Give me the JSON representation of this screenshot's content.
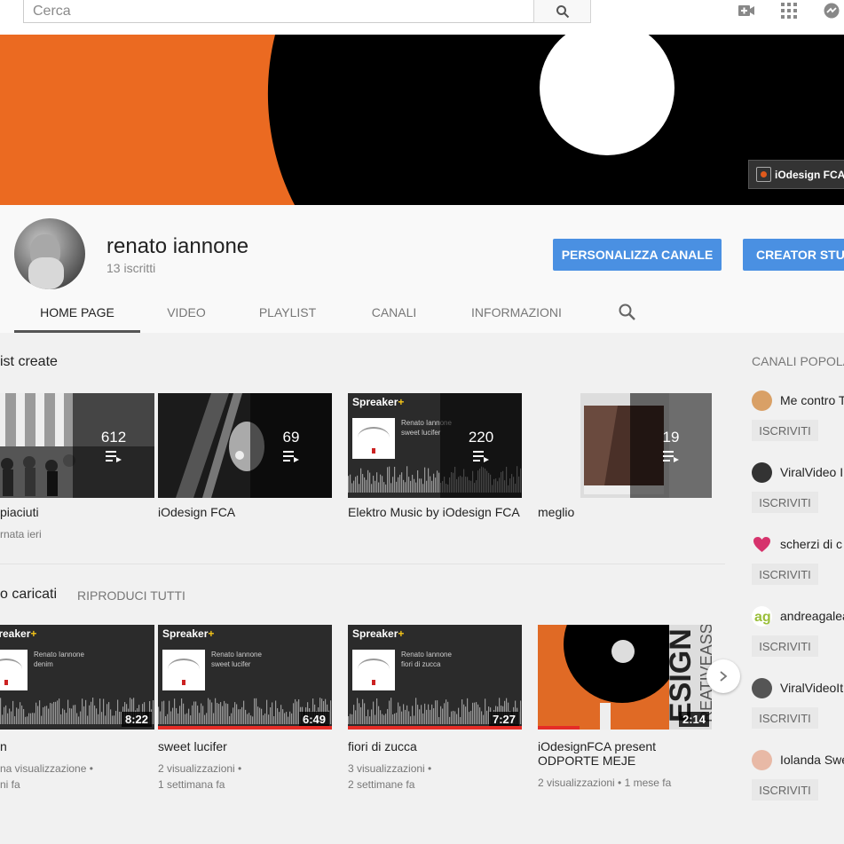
{
  "search": {
    "placeholder": "Cerca"
  },
  "icons": {
    "search": "search-icon",
    "upload": "video-camera-add-icon",
    "apps": "apps-grid-icon",
    "chat": "chat-bubble-icon",
    "tab_search": "search-icon",
    "next": "chevron-right-icon"
  },
  "colors": {
    "banner_orange": "#eb6a21",
    "button_blue": "#4a90e2",
    "progress_red": "#e52d27"
  },
  "banner": {
    "badge_text": "iOdesign FCA O"
  },
  "channel": {
    "name": "renato iannone",
    "subscribers": "13 iscritti",
    "customize_button": "PERSONALIZZA CANALE",
    "studio_button": "CREATOR STUD"
  },
  "tabs": [
    {
      "label": "HOME PAGE"
    },
    {
      "label": "VIDEO"
    },
    {
      "label": "PLAYLIST"
    },
    {
      "label": "CANALI"
    },
    {
      "label": "INFORMAZIONI"
    }
  ],
  "playlists_section": {
    "title": "ist create",
    "items": [
      {
        "count": "612",
        "title": "piaciuti",
        "meta": "rnata ieri"
      },
      {
        "count": "69",
        "title": "iOdesign FCA",
        "meta": ""
      },
      {
        "count": "220",
        "title": "Elektro Music by iOdesign FCA",
        "meta": "",
        "spk_author": "Renato Iannone",
        "spk_track": "sweet lucifer"
      },
      {
        "count": "19",
        "title": "meglio",
        "meta": ""
      }
    ]
  },
  "uploads_section": {
    "title": "o caricati",
    "play_all": "RIPRODUCI TUTTI",
    "items": [
      {
        "duration": "8:22",
        "title": "n",
        "meta1": "na visualizzazione •",
        "meta2": "ni fa",
        "spk_author": "Renato Iannone",
        "spk_track": "denim"
      },
      {
        "duration": "6:49",
        "title": "sweet lucifer",
        "meta1": "2 visualizzazioni •",
        "meta2": "1 settimana fa",
        "spk_author": "Renato Iannone",
        "spk_track": "sweet lucifer"
      },
      {
        "duration": "7:27",
        "title": "fiori di zucca",
        "meta1": "3 visualizzazioni •",
        "meta2": "2 settimane fa",
        "spk_author": "Renato Iannone",
        "spk_track": "fiori di zucca"
      },
      {
        "duration": "2:14",
        "title": "iOdesignFCA present ODPORTE MEJE",
        "meta1": "2 visualizzazioni • 1 mese fa",
        "meta2": ""
      }
    ],
    "spreaker_label": "Spreaker"
  },
  "sidebar": {
    "title": "CANALI POPOLA",
    "subscribe_label": "ISCRIVITI",
    "channels": [
      {
        "name": "Me contro T"
      },
      {
        "name": "ViralVideo I"
      },
      {
        "name": "scherzi di c"
      },
      {
        "name": "andreagalea"
      },
      {
        "name": "ViralVideoIt"
      },
      {
        "name": "Iolanda Swe"
      }
    ]
  }
}
